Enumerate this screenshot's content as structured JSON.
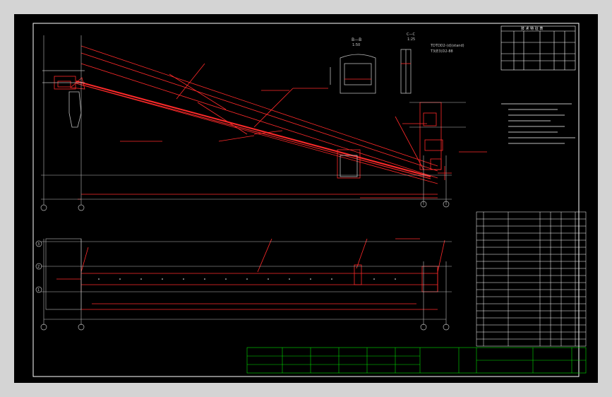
{
  "window": {
    "background": "#d4d4d4",
    "canvas_background": "#000000"
  },
  "colors": {
    "frame": "#ffffff",
    "red": "#ff2a2a",
    "green": "#00e000",
    "grey_text": "#c8c8c8"
  },
  "labels": {
    "section_bb": "B—B",
    "section_bb_scale": "1:50",
    "section_cc": "C—C",
    "section_cc_scale": "1:25",
    "note_right_1": "TDTDD2-(d)(stand)",
    "note_right_2": "T3(E3)D2-88",
    "table_title": "技 术 特 征 表",
    "axis_a": "A",
    "axis_b": "B",
    "axis_c": "C",
    "axis_d": "D",
    "axis_e": "E",
    "axis_1": "1",
    "axis_2": "2",
    "axis_3": "3"
  }
}
